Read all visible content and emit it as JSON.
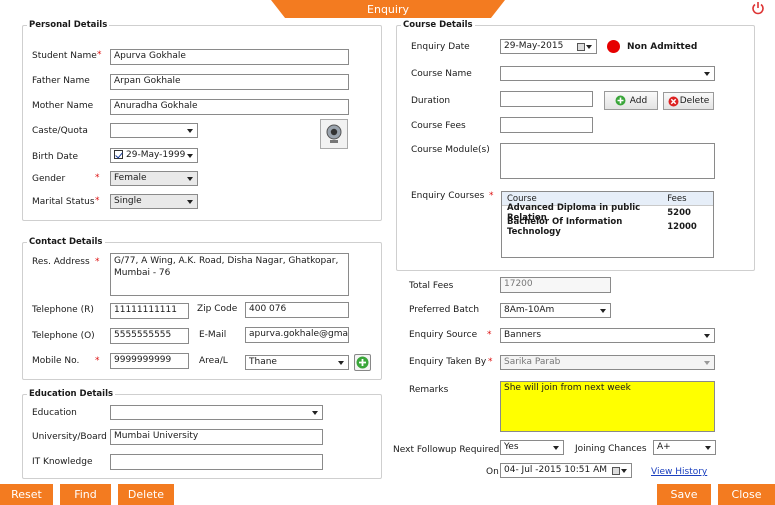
{
  "window": {
    "title": "Enquiry"
  },
  "personal": {
    "legend": "Personal Details",
    "student_name_label": "Student Name",
    "student_name": "Apurva Gokhale",
    "father_name_label": "Father Name",
    "father_name": "Arpan Gokhale",
    "mother_name_label": "Mother Name",
    "mother_name": "Anuradha Gokhale",
    "caste_label": "Caste/Quota",
    "caste": "",
    "birth_date_label": "Birth Date",
    "birth_date": "29-May-1999",
    "gender_label": "Gender",
    "gender": "Female",
    "marital_label": "Marital Status",
    "marital": "Single"
  },
  "contact": {
    "legend": "Contact Details",
    "address_label": "Res. Address",
    "address": "G/77, A Wing, A.K. Road, Disha Nagar, Ghatkopar, Mumbai - 76",
    "tel_r_label": "Telephone (R)",
    "tel_r": "11111111111",
    "zip_label": "Zip Code",
    "zip": "400 076",
    "tel_o_label": "Telephone (O)",
    "tel_o": "5555555555",
    "email_label": "E-Mail",
    "email": "apurva.gokhale@gmail.",
    "mobile_label": "Mobile No.",
    "mobile": "9999999999",
    "area_label": "Area/L",
    "area": "Thane"
  },
  "education": {
    "legend": "Education Details",
    "education_label": "Education",
    "education": "",
    "university_label": "University/Board",
    "university": "Mumbai University",
    "it_label": "IT Knowledge",
    "it": ""
  },
  "course": {
    "legend": "Course Details",
    "enquiry_date_label": "Enquiry Date",
    "enquiry_date": "29-May-2015",
    "status": "Non Admitted",
    "status_color": "#e60000",
    "course_name_label": "Course Name",
    "course_name": "",
    "duration_label": "Duration",
    "duration": "",
    "add_label": "Add",
    "delete_label": "Delete",
    "fees_label": "Course Fees",
    "fees": "",
    "modules_label": "Course Module(s)",
    "modules": "",
    "enquiry_courses_label": "Enquiry Courses",
    "grid_headers": [
      "Course",
      "Fees"
    ],
    "grid_rows": [
      [
        "Advanced Diploma in public Relation",
        "5200"
      ],
      [
        "Bachelor Of Information Technology",
        "12000"
      ]
    ]
  },
  "summary": {
    "total_fees_label": "Total Fees",
    "total_fees": "17200",
    "batch_label": "Preferred Batch",
    "batch": "8Am-10Am",
    "source_label": "Enquiry Source",
    "source": "Banners",
    "taken_by_label": "Enquiry Taken By",
    "taken_by": "Sarika Parab",
    "remarks_label": "Remarks",
    "remarks": "She will join from next week",
    "remarks_bg": "#ffff00",
    "followup_label": "Next Followup Required",
    "followup": "Yes",
    "chances_label": "Joining Chances",
    "chances": "A+",
    "on_label": "On",
    "on_date": "04- Jul -2015 10:51 AM",
    "history_link": "View History"
  },
  "footer": {
    "reset": "Reset",
    "find": "Find",
    "delete": "Delete",
    "save": "Save",
    "close": "Close",
    "accent": "#f37b20"
  }
}
